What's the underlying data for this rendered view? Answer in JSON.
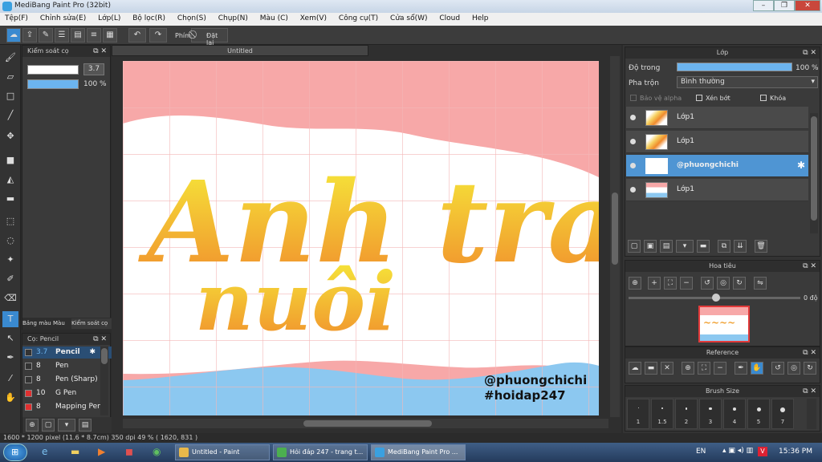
{
  "window": {
    "title": "MediBang Paint Pro (32bit)"
  },
  "menu": [
    "Tệp(F)",
    "Chỉnh sửa(E)",
    "Lớp(L)",
    "Bộ lọc(R)",
    "Chọn(S)",
    "Chụp(N)",
    "Màu (C)",
    "Xem(V)",
    "Công cụ(T)",
    "Cửa sổ(W)",
    "Cloud",
    "Help"
  ],
  "toolbar": {
    "key_label": "Phím",
    "reset_label": "Đặt lại"
  },
  "brush_control": {
    "title": "Kiểm soát cọ",
    "size_value": "3.7",
    "opacity_value": "100 %",
    "opacity_level": 1.0,
    "tabs": [
      "Bảng màu",
      "Màu",
      "Kiểm soát cọ"
    ]
  },
  "brush_panel": {
    "title": "Cọ: Pencil",
    "items": [
      {
        "size": "3.7",
        "name": "Pencil",
        "color": "#333333",
        "selected": true
      },
      {
        "size": "8",
        "name": "Pen",
        "color": "#333333",
        "selected": false
      },
      {
        "size": "8",
        "name": "Pen (Sharp)",
        "color": "#333333",
        "selected": false
      },
      {
        "size": "10",
        "name": "G Pen",
        "color": "#e03030",
        "selected": false
      },
      {
        "size": "8",
        "name": "Mapping Pen",
        "color": "#e03030",
        "selected": false
      }
    ]
  },
  "document": {
    "tab_title": "Untitled",
    "artwork_text": {
      "line1": "Anh trai",
      "line2": "nuôi",
      "watermark1": "@phuongchichi",
      "watermark2": "#hoidap247"
    },
    "colors": {
      "top": "#f7a8a8",
      "mid": "#ffffff",
      "bottom": "#8cc8f0",
      "grid": "#f3b7b7",
      "text_a": "#f6ec3a",
      "text_b": "#f08a2c"
    }
  },
  "layers_panel": {
    "title": "Lớp",
    "opacity_label": "Độ trong",
    "opacity_value": "100 %",
    "opacity_level": 1.0,
    "blend_label": "Pha trộn",
    "blend_value": "Bình thường",
    "protect_alpha": "Bảo vệ alpha",
    "clipping": "Xén bớt",
    "lock": "Khóa",
    "layers": [
      {
        "name": "Lớp1",
        "selected": false
      },
      {
        "name": "Lớp1",
        "selected": false
      },
      {
        "name": "@phuongchichi",
        "selected": true
      },
      {
        "name": "Lớp1",
        "selected": false
      }
    ]
  },
  "navigator": {
    "title": "Hoa tiêu",
    "angle": "0 độ"
  },
  "reference": {
    "title": "Reference"
  },
  "brush_size": {
    "title": "Brush Size",
    "sizes": [
      "1",
      "1.5",
      "2",
      "3",
      "4",
      "5",
      "7"
    ]
  },
  "status": {
    "text": "1600 * 1200 pixel   (11.6 * 8.7cm)   350 dpi   49 %   ( 1620, 831 )"
  },
  "taskbar": {
    "tasks": [
      {
        "label": "Untitled - Paint",
        "color": "#e8b84a"
      },
      {
        "label": "Hỏi đáp 247 - trang t...",
        "color": "#4caf50"
      },
      {
        "label": "MediBang Paint Pro ...",
        "color": "#3aa0e0"
      }
    ],
    "lang": "EN",
    "clock": "15:36 PM"
  }
}
